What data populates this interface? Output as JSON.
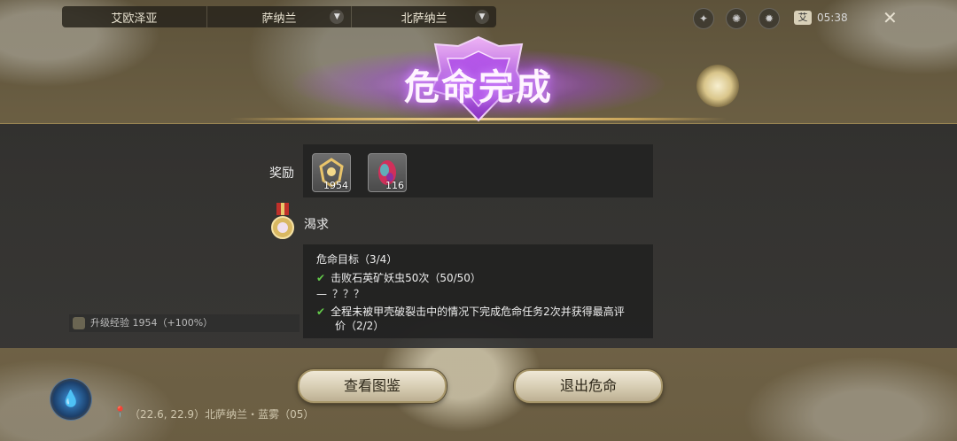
{
  "regions": [
    {
      "label": "艾欧泽亚",
      "has_dropdown": false
    },
    {
      "label": "萨纳兰",
      "has_dropdown": true
    },
    {
      "label": "北萨纳兰",
      "has_dropdown": true
    }
  ],
  "top_right": {
    "char_badge": "艾",
    "time": "05:38"
  },
  "title": "危命完成",
  "reward_label": "奖励",
  "rewards": [
    {
      "icon": "gold-knot-icon",
      "qty": "1954"
    },
    {
      "icon": "gem-icon",
      "qty": "116"
    }
  ],
  "mission_name": "渴求",
  "objective_header": "危命目标（3/4）",
  "objectives": [
    {
      "status": "done",
      "text": "击败石英矿妖虫50次（50/50）"
    },
    {
      "status": "unknown",
      "text": "？？？"
    },
    {
      "status": "done",
      "text": "全程未被甲壳破裂击中的情况下完成危命任务2次并获得最高评"
    },
    {
      "status": "cont",
      "text": "价（2/2）"
    }
  ],
  "exp_text": "升级经验 1954（+100%）",
  "buttons": {
    "view": "查看图鉴",
    "exit": "退出危命"
  },
  "location": "（22.6, 22.9）北萨纳兰・蓝雾（05）"
}
